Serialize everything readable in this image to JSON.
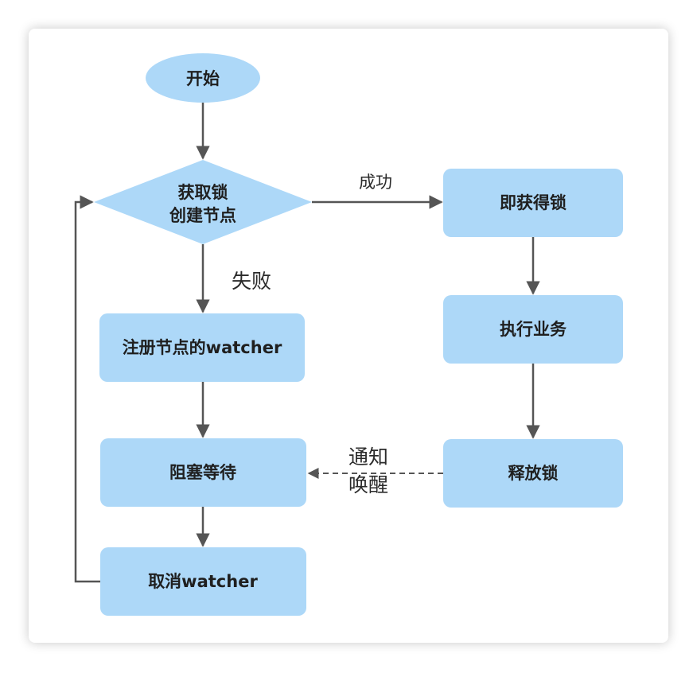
{
  "colors": {
    "node_fill": "#add8f8",
    "edge": "#555555",
    "text": "#1f1f1f"
  },
  "nodes": {
    "start": "开始",
    "acquire_line1": "获取锁",
    "acquire_line2": "创建节点",
    "got_lock": "即获得锁",
    "execute": "执行业务",
    "release": "释放锁",
    "register": "注册节点的watcher",
    "block": "阻塞等待",
    "cancel": "取消watcher"
  },
  "edges": {
    "success": "成功",
    "fail": "失败",
    "notify_line1": "通知",
    "notify_line2": "唤醒"
  }
}
